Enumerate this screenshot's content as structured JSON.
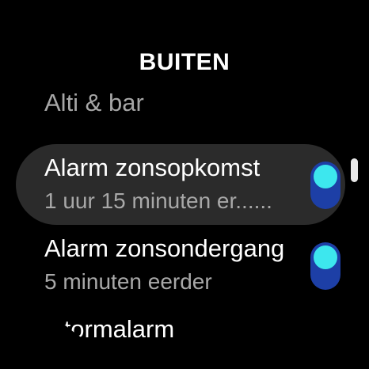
{
  "header": {
    "title": "BUITEN"
  },
  "list": {
    "previous_item": "Alti & bar",
    "items": [
      {
        "title": "Alarm zonsopkomst",
        "subtitle": "1 uur 15 minuten er......",
        "toggle_on": true,
        "selected": true
      },
      {
        "title": "Alarm zonsondergang",
        "subtitle": "5 minuten eerder",
        "toggle_on": true,
        "selected": false
      }
    ],
    "next_item": "Stormalarm"
  },
  "colors": {
    "background": "#000000",
    "selected_row": "#2b2b2b",
    "toggle_track": "#1d3fa6",
    "toggle_knob": "#3de7ee",
    "secondary_text": "#a8a8a8"
  }
}
